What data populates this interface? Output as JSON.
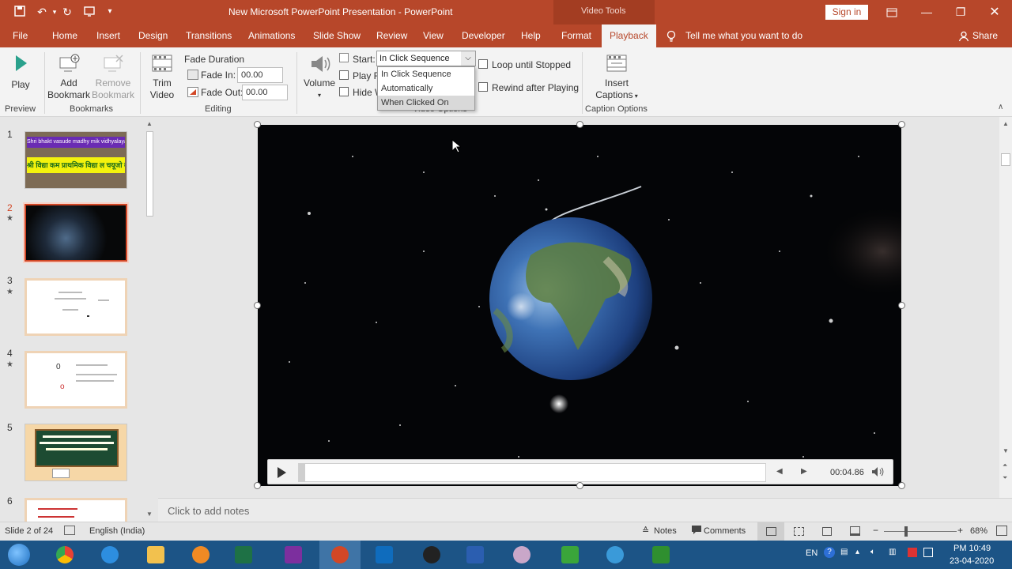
{
  "window": {
    "title": "New Microsoft PowerPoint Presentation  -  PowerPoint",
    "context_tab_group": "Video Tools",
    "sign_in": "Sign in"
  },
  "tabs": [
    "File",
    "Home",
    "Insert",
    "Design",
    "Transitions",
    "Animations",
    "Slide Show",
    "Review",
    "View",
    "Developer",
    "Help",
    "Format",
    "Playback"
  ],
  "active_tab": "Playback",
  "tell_me": "Tell me what you want to do",
  "share": "Share",
  "ribbon": {
    "preview": {
      "play": "Play",
      "label": "Preview"
    },
    "bookmarks": {
      "add_line1": "Add",
      "add_line2": "Bookmark",
      "remove_line1": "Remove",
      "remove_line2": "Bookmark",
      "label": "Bookmarks"
    },
    "editing": {
      "trim_line1": "Trim",
      "trim_line2": "Video",
      "fade_duration": "Fade Duration",
      "fade_in_label": "Fade In:",
      "fade_in_value": "00.00",
      "fade_out_label": "Fade Out:",
      "fade_out_value": "00.00",
      "label": "Editing"
    },
    "video_options": {
      "volume": "Volume",
      "start_label": "Start:",
      "start_value": "In Click Sequence",
      "play_full": "Play Fu",
      "hide": "Hide W",
      "loop": "Loop until Stopped",
      "rewind": "Rewind after Playing",
      "label": "Video Options"
    },
    "captions": {
      "insert_line1": "Insert",
      "insert_line2": "Captions",
      "label": "Caption Options"
    }
  },
  "start_dropdown": {
    "options": [
      "In Click Sequence",
      "Automatically",
      "When Clicked On"
    ],
    "highlighted": "When Clicked On"
  },
  "slides": [
    {
      "num": "1",
      "star": ""
    },
    {
      "num": "2",
      "star": "★"
    },
    {
      "num": "3",
      "star": "★"
    },
    {
      "num": "4",
      "star": "★"
    },
    {
      "num": "5",
      "star": ""
    },
    {
      "num": "6",
      "star": ""
    }
  ],
  "slide1_text": {
    "top": "Shri bhakt vasude madhy mik vidhyalaya, bhu cnt",
    "hindi": "श्री विद्या कम प्राथमिक विद्या ल चयूजो वाडी"
  },
  "slide4_text": {
    "o1": "0",
    "o2": "o"
  },
  "video": {
    "time": "00:04.86"
  },
  "notes_placeholder": "Click to add notes",
  "status": {
    "slide": "Slide 2 of 24",
    "language": "English (India)",
    "notes": "Notes",
    "comments": "Comments",
    "zoom": "68%"
  },
  "taskbar": {
    "lang": "EN",
    "time": "PM 10:49",
    "date": "23-04-2020"
  },
  "colors": {
    "accent": "#b7472a",
    "taskbar": "#1c5486"
  }
}
